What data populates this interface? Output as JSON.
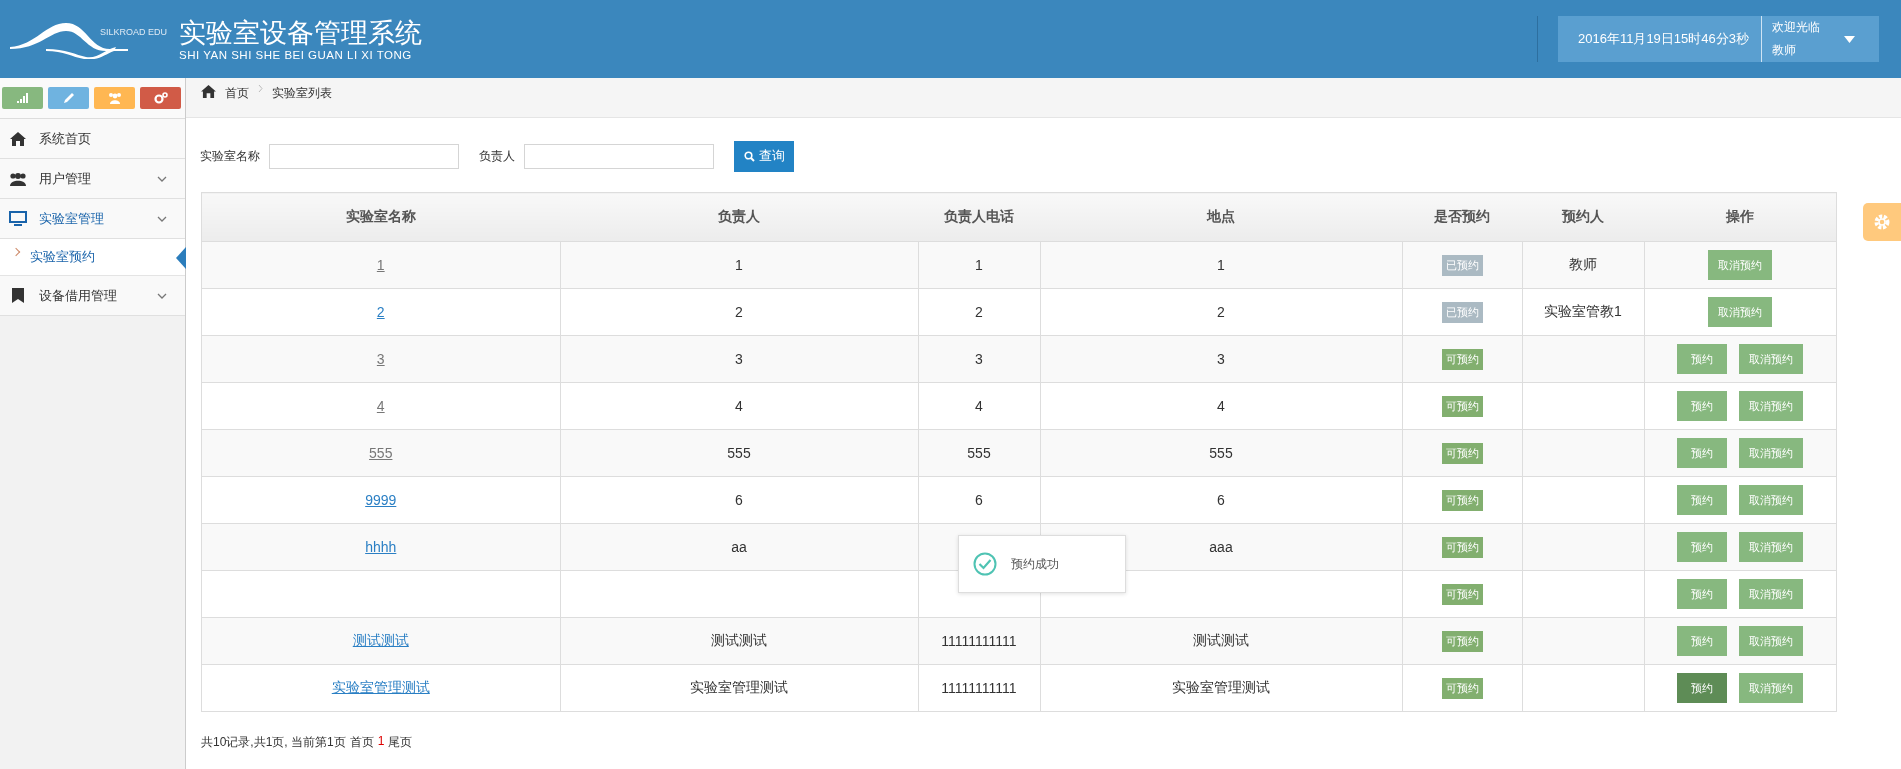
{
  "header": {
    "brand": "SILKROAD EDU",
    "title": "实验室设备管理系统",
    "subtitle": "SHI YAN SHI SHE BEI GUAN LI XI TONG",
    "datetime": "2016年11月19日15时46分3秒",
    "welcome": "欢迎光临",
    "user": "教师"
  },
  "shortcuts": [
    {
      "kind": "chart"
    },
    {
      "kind": "pencil"
    },
    {
      "kind": "users"
    },
    {
      "kind": "gears"
    }
  ],
  "sidebar": {
    "items": [
      {
        "label": "系统首页",
        "expandable": false,
        "expanded": false
      },
      {
        "label": "用户管理",
        "expandable": true,
        "expanded": false
      },
      {
        "label": "实验室管理",
        "expandable": true,
        "expanded": true,
        "children": [
          {
            "label": "实验室预约",
            "selected": true
          }
        ]
      },
      {
        "label": "设备借用管理",
        "expandable": true,
        "expanded": false
      }
    ]
  },
  "breadcrumb": [
    "首页",
    "实验室列表"
  ],
  "search": {
    "fields": [
      {
        "label": "实验室名称"
      },
      {
        "label": "负责人"
      }
    ],
    "button": "查询"
  },
  "table": {
    "columns": [
      "实验室名称",
      "负责人",
      "负责人电话",
      "地点",
      "是否预约",
      "预约人",
      "操作"
    ],
    "rows": [
      {
        "name": "1",
        "visited": true,
        "manager": "1",
        "phone": "1",
        "place": "1",
        "status": "已预约",
        "booked": true,
        "booker": "教师",
        "actions": [
          "取消预约"
        ]
      },
      {
        "name": "2",
        "visited": false,
        "manager": "2",
        "phone": "2",
        "place": "2",
        "status": "已预约",
        "booked": true,
        "booker": "实验室管教1",
        "actions": [
          "取消预约"
        ]
      },
      {
        "name": "3",
        "visited": true,
        "manager": "3",
        "phone": "3",
        "place": "3",
        "status": "可预约",
        "booked": false,
        "actions": [
          "预约",
          "取消预约"
        ]
      },
      {
        "name": "4",
        "visited": true,
        "manager": "4",
        "phone": "4",
        "place": "4",
        "status": "可预约",
        "booked": false,
        "actions": [
          "预约",
          "取消预约"
        ]
      },
      {
        "name": "555",
        "visited": true,
        "manager": "555",
        "phone": "555",
        "place": "555",
        "status": "可预约",
        "booked": false,
        "actions": [
          "预约",
          "取消预约"
        ]
      },
      {
        "name": "9999",
        "visited": false,
        "manager": "6",
        "phone": "6",
        "place": "6",
        "status": "可预约",
        "booked": false,
        "actions": [
          "预约",
          "取消预约"
        ]
      },
      {
        "name": "hhhh",
        "visited": false,
        "manager": "aa",
        "place": "aaa",
        "status": "可预约",
        "booked": false,
        "actions": [
          "预约",
          "取消预约"
        ]
      },
      {
        "status": "可预约",
        "booked": false,
        "actions": [
          "预约",
          "取消预约"
        ]
      },
      {
        "name": "测试测试",
        "visited": false,
        "manager": "测试测试",
        "phone": "11111111111",
        "place": "测试测试",
        "status": "可预约",
        "booked": false,
        "actions": [
          "预约",
          "取消预约"
        ]
      },
      {
        "name": "实验室管理测试",
        "visited": false,
        "manager": "实验室管理测试",
        "phone": "11111111111",
        "place": "实验室管理测试",
        "status": "可预约",
        "booked": false,
        "actions": [
          "预约",
          "取消预约"
        ],
        "hovered": true
      }
    ]
  },
  "toast": {
    "message": "预约成功"
  },
  "pagination": {
    "summary": "共10记录,共1页, 当前第1页",
    "first": "首页",
    "current": "1",
    "last": "尾页"
  }
}
